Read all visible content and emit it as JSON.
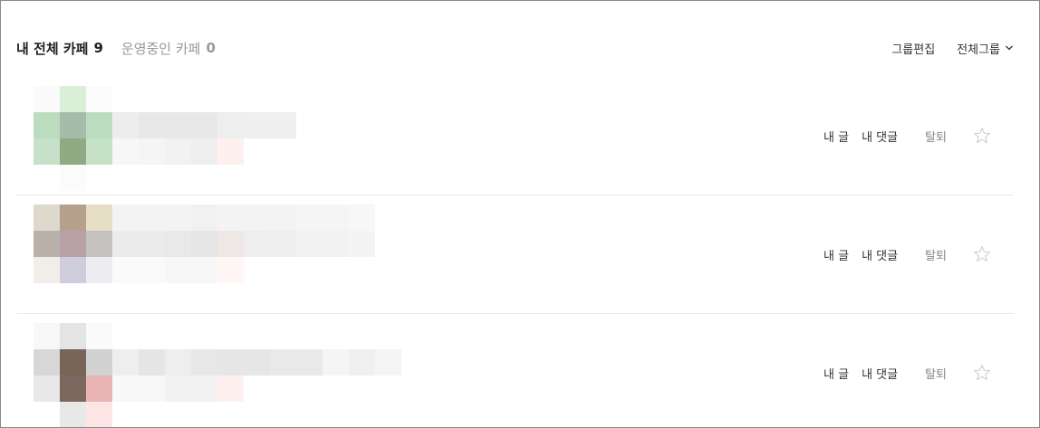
{
  "header": {
    "my_cafes_label": "내 전체 카페",
    "my_cafes_count": "9",
    "managed_label": "운영중인 카페",
    "managed_count": "0",
    "group_edit": "그룹편집",
    "group_select": "전체그룹"
  },
  "rows": [
    {
      "my_posts": "내 글",
      "my_comments": "내 댓글",
      "leave": "탈퇴",
      "cells": [
        [
          0,
          0,
          "#fafafa"
        ],
        [
          1,
          0,
          "#dbeed8"
        ],
        [
          2,
          0,
          "#fbfbfb"
        ],
        [
          0,
          1,
          "#bcdcc0"
        ],
        [
          1,
          1,
          "#a5bca8"
        ],
        [
          2,
          1,
          "#bcdcc0"
        ],
        [
          3,
          1,
          "#ededed"
        ],
        [
          4,
          1,
          "#e8e8e8"
        ],
        [
          5,
          1,
          "#e8e8e8"
        ],
        [
          6,
          1,
          "#e8e8e8"
        ],
        [
          7,
          1,
          "#eeeeee"
        ],
        [
          8,
          1,
          "#efefef"
        ],
        [
          9,
          1,
          "#efefef"
        ],
        [
          0,
          2,
          "#c7e0c9"
        ],
        [
          1,
          2,
          "#90ab83"
        ],
        [
          2,
          2,
          "#c5e2c6"
        ],
        [
          3,
          2,
          "#f7f7f7"
        ],
        [
          4,
          2,
          "#f5f5f5"
        ],
        [
          5,
          2,
          "#f2f2f2"
        ],
        [
          6,
          2,
          "#eeeeee"
        ],
        [
          7,
          2,
          "#fff0f0"
        ],
        [
          1,
          3,
          "#fbfbfb"
        ]
      ]
    },
    {
      "my_posts": "내 글",
      "my_comments": "내 댓글",
      "leave": "탈퇴",
      "cells": [
        [
          0,
          0,
          "#ddd9cc"
        ],
        [
          1,
          0,
          "#b5a18b"
        ],
        [
          2,
          0,
          "#e6dfc6"
        ],
        [
          3,
          0,
          "#f3f3f3"
        ],
        [
          4,
          0,
          "#f3f3f3"
        ],
        [
          5,
          0,
          "#f3f3f3"
        ],
        [
          6,
          0,
          "#f1f1f1"
        ],
        [
          7,
          0,
          "#f3f3f3"
        ],
        [
          8,
          0,
          "#f3f3f3"
        ],
        [
          9,
          0,
          "#f3f3f3"
        ],
        [
          10,
          0,
          "#f5f5f5"
        ],
        [
          11,
          0,
          "#f5f5f5"
        ],
        [
          12,
          0,
          "#f7f7f7"
        ],
        [
          0,
          1,
          "#b9b1aa"
        ],
        [
          1,
          1,
          "#b8a1a6"
        ],
        [
          2,
          1,
          "#c4c1be"
        ],
        [
          3,
          1,
          "#ececec"
        ],
        [
          4,
          1,
          "#ebebeb"
        ],
        [
          5,
          1,
          "#e9e9e9"
        ],
        [
          6,
          1,
          "#e6e6e6"
        ],
        [
          7,
          1,
          "#efe6e6"
        ],
        [
          8,
          1,
          "#eeeeee"
        ],
        [
          9,
          1,
          "#efefef"
        ],
        [
          10,
          1,
          "#f2f2f2"
        ],
        [
          11,
          1,
          "#f2f2f2"
        ],
        [
          12,
          1,
          "#f4f4f4"
        ],
        [
          0,
          2,
          "#f1eeea"
        ],
        [
          1,
          2,
          "#cfcddb"
        ],
        [
          2,
          2,
          "#ededf1"
        ],
        [
          3,
          2,
          "#fafafa"
        ],
        [
          4,
          2,
          "#fafafa"
        ],
        [
          5,
          2,
          "#f7f7f7"
        ],
        [
          6,
          2,
          "#f7f7f7"
        ],
        [
          7,
          2,
          "#fff6f6"
        ]
      ]
    },
    {
      "my_posts": "내 글",
      "my_comments": "내 댓글",
      "leave": "탈퇴",
      "cells": [
        [
          0,
          0,
          "#f8f8f8"
        ],
        [
          1,
          0,
          "#e4e4e4"
        ],
        [
          2,
          0,
          "#fafafa"
        ],
        [
          0,
          1,
          "#d7d7d7"
        ],
        [
          1,
          1,
          "#796458"
        ],
        [
          2,
          1,
          "#d2d2d2"
        ],
        [
          3,
          1,
          "#eeeeee"
        ],
        [
          4,
          1,
          "#e5e5e5"
        ],
        [
          5,
          1,
          "#eeeeee"
        ],
        [
          6,
          1,
          "#e8e8e8"
        ],
        [
          7,
          1,
          "#e6e6e6"
        ],
        [
          8,
          1,
          "#e6e6e6"
        ],
        [
          9,
          1,
          "#e9e9e9"
        ],
        [
          10,
          1,
          "#e9e9e9"
        ],
        [
          11,
          1,
          "#f5f5f5"
        ],
        [
          12,
          1,
          "#f0f0f0"
        ],
        [
          13,
          1,
          "#f5f5f5"
        ],
        [
          0,
          2,
          "#e8e8e8"
        ],
        [
          1,
          2,
          "#7c685f"
        ],
        [
          2,
          2,
          "#e8b4b4"
        ],
        [
          3,
          2,
          "#f8f8f8"
        ],
        [
          4,
          2,
          "#f8f8f8"
        ],
        [
          5,
          2,
          "#f2f2f2"
        ],
        [
          6,
          2,
          "#f2f2f2"
        ],
        [
          7,
          2,
          "#fff0f0"
        ],
        [
          1,
          3,
          "#e8e8e8"
        ],
        [
          2,
          3,
          "#ffe6e6"
        ]
      ]
    }
  ],
  "colors": {
    "star_stroke": "#cfcfcf",
    "divider": "#e9e9e9",
    "muted_text": "#9a9a9a"
  },
  "icons": {
    "group_dropdown": "chevron-down-icon",
    "favorite": "star-icon"
  }
}
